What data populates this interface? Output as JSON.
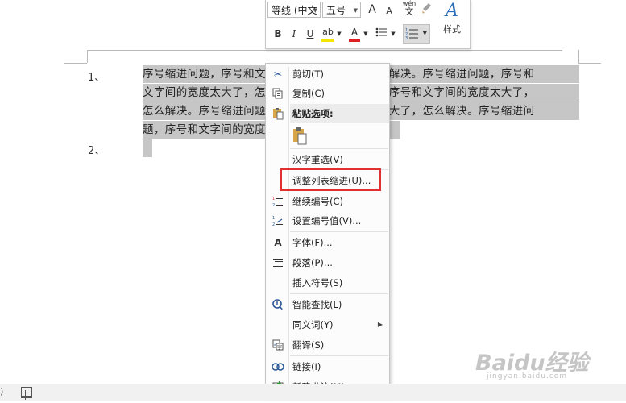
{
  "document": {
    "list_number_1": "1、",
    "list_number_2": "2、",
    "lines": [
      "序号缩进问题，序号和文字间的宽度太大了，怎么解决。序号缩进问题，序号和",
      "文字间的宽度太大了，怎么解决。序号缩进问题，序号和文字间的宽度太大了，",
      "怎么解决。序号缩进问题，序号和文字间的宽度太大了，怎么解决。序号缩进问",
      "题，序号和文字间的宽度太大了，怎么解决。"
    ]
  },
  "mini_toolbar": {
    "font_name": "等线 (中文",
    "font_size": "五号",
    "grow_font": "A",
    "shrink_font": "A",
    "phonetic_top": "wén",
    "phonetic_bottom": "文",
    "bold": "B",
    "italic": "I",
    "underline": "U",
    "highlight": "ab",
    "font_color": "A",
    "styles_label": "样式",
    "styles_glyph": "A",
    "highlight_color": "#f2e600",
    "font_color_value": "#e02020"
  },
  "context_menu": {
    "items": [
      {
        "icon": "scissors-icon",
        "label": "剪切(T)"
      },
      {
        "icon": "copy-icon",
        "label": "复制(C)"
      },
      {
        "icon": "paste-icon",
        "label": "粘贴选项:"
      },
      {
        "icon": "",
        "label": "汉字重选(V)"
      },
      {
        "icon": "",
        "label": "调整列表缩进(U)..."
      },
      {
        "icon": "continue-numbering-icon",
        "label": "继续编号(C)"
      },
      {
        "icon": "set-number-value-icon",
        "label": "设置编号值(V)..."
      },
      {
        "icon": "font-icon",
        "label": "字体(F)..."
      },
      {
        "icon": "paragraph-icon",
        "label": "段落(P)..."
      },
      {
        "icon": "",
        "label": "插入符号(S)"
      },
      {
        "icon": "smart-lookup-icon",
        "label": "智能查找(L)"
      },
      {
        "icon": "",
        "label": "同义词(Y)"
      },
      {
        "icon": "translate-icon",
        "label": "翻译(S)"
      },
      {
        "icon": "link-icon",
        "label": "链接(I)"
      },
      {
        "icon": "new-comment-icon",
        "label": "新建批注(M)"
      }
    ],
    "highlight_color": "#e03030"
  },
  "watermark": {
    "text": "Baidu经验",
    "sub": "jingyan.baidu.com"
  }
}
